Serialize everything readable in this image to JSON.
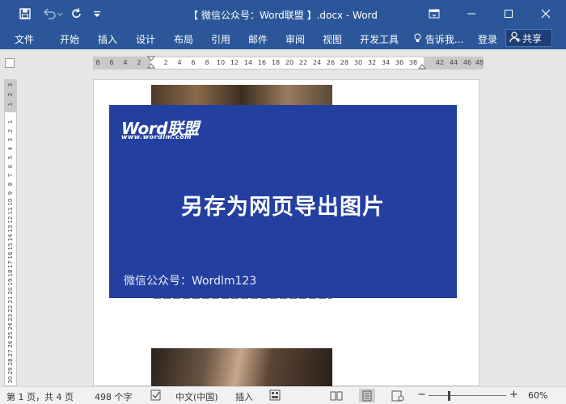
{
  "window": {
    "title": "【 微信公众号：Word联盟 】.docx - Word",
    "qa_icons": [
      "save-icon",
      "undo-icon",
      "redo-icon",
      "customize-icon"
    ],
    "controls": [
      "ribbon-display-icon",
      "minimize-icon",
      "maximize-icon",
      "close-icon"
    ]
  },
  "ribbon": {
    "tabs": [
      "文件",
      "开始",
      "插入",
      "设计",
      "布局",
      "引用",
      "邮件",
      "审阅",
      "视图",
      "开发工具"
    ],
    "tell_me": "告诉我...",
    "login": "登录",
    "share": "共享"
  },
  "ruler": {
    "h_left": [
      "8",
      "6",
      "4",
      "2"
    ],
    "h_right": [
      "2",
      "4",
      "6",
      "8",
      "10",
      "12",
      "14",
      "16",
      "18",
      "20",
      "22",
      "24",
      "26",
      "28",
      "30",
      "32",
      "34",
      "36",
      "38",
      "42",
      "44",
      "46",
      "48"
    ],
    "v": [
      "3",
      "2",
      "1",
      "1",
      "2",
      "3",
      "4",
      "5",
      "6",
      "7",
      "8",
      "9",
      "10",
      "11",
      "12",
      "13",
      "14",
      "15",
      "16",
      "17",
      "18",
      "19",
      "20",
      "21",
      "22",
      "23",
      "24",
      "25",
      "26",
      "27",
      "28",
      "29",
      "30"
    ]
  },
  "document": {
    "banner": {
      "logo": "Word联盟",
      "logo_url": "www.wordlm.com",
      "headline": "另存为网页导出图片",
      "wechat": "微信公众号：Wordlm123"
    },
    "colors": {
      "banner": "#2340a0",
      "ribbon": "#2b579a"
    }
  },
  "statusbar": {
    "page": "第 1 页，共 4 页",
    "words": "498 个字",
    "language": "中文(中国)",
    "mode": "插入",
    "zoom": "60%",
    "zoom_value": 60
  }
}
